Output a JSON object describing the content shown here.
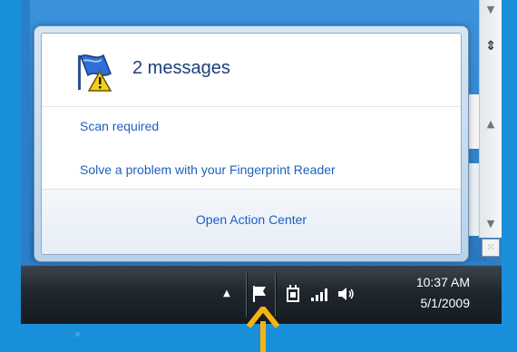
{
  "popup": {
    "count_title": "2 messages",
    "messages": [
      {
        "label": "Scan required"
      },
      {
        "label": "Solve a problem with your Fingerprint Reader"
      }
    ],
    "footer_link": "Open Action Center"
  },
  "tray": {
    "show_hidden_icon": "▲",
    "flag_icon": "action-center-flag-icon",
    "power_icon": "power-plug-icon",
    "network_icon": "network-signal-icon",
    "volume_icon": "speaker-volume-icon"
  },
  "clock": {
    "time": "10:37 AM",
    "date": "5/1/2009"
  },
  "colors": {
    "background": "#1a8fd9",
    "link": "#1e5fbf",
    "title": "#1c3f7a",
    "arrow": "#f5b312"
  }
}
